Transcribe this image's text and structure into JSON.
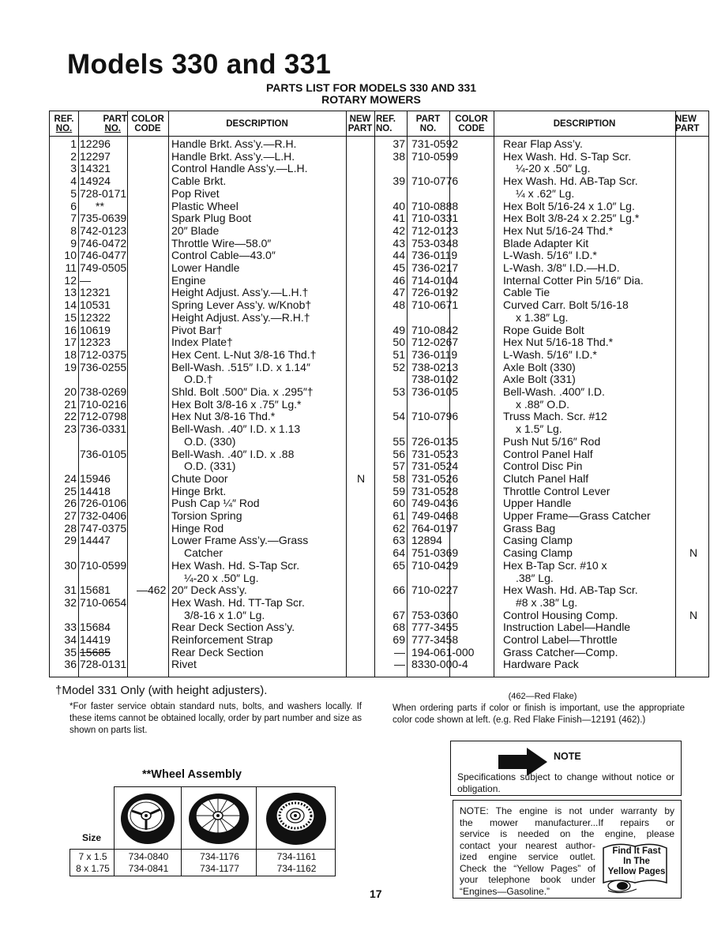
{
  "page": {
    "title": "Models 330 and 331",
    "subtitle_line1": "PARTS LIST FOR MODELS 330 AND 331",
    "subtitle_line2": "ROTARY MOWERS",
    "page_number": "17"
  },
  "table": {
    "headers": {
      "ref_no": [
        "REF.",
        "NO."
      ],
      "part_no": [
        "PART",
        "NO."
      ],
      "color_code": [
        "COLOR",
        "CODE"
      ],
      "description": "DESCRIPTION",
      "new_part": [
        "NEW",
        "PART"
      ]
    },
    "left_rows": [
      {
        "ref": "1",
        "part": "12296",
        "color": "",
        "desc": "Handle Brkt. Ass’y.—R.H.",
        "new": ""
      },
      {
        "ref": "2",
        "part": "12297",
        "color": "",
        "desc": "Handle Brkt. Ass’y.—L.H.",
        "new": ""
      },
      {
        "ref": "3",
        "part": "14321",
        "color": "",
        "desc": "Control Handle Ass’y.—L.H.",
        "new": ""
      },
      {
        "ref": "4",
        "part": "14924",
        "color": "",
        "desc": "Cable Brkt.",
        "new": ""
      },
      {
        "ref": "5",
        "part": "728-0171",
        "color": "",
        "desc": "Pop Rivet",
        "new": ""
      },
      {
        "ref": "6",
        "part": "**",
        "color": "",
        "desc": "Plastic Wheel",
        "new": ""
      },
      {
        "ref": "7",
        "part": "735-0639",
        "color": "",
        "desc": "Spark Plug Boot",
        "new": ""
      },
      {
        "ref": "8",
        "part": "742-0123",
        "color": "",
        "desc": "20″ Blade",
        "new": ""
      },
      {
        "ref": "9",
        "part": "746-0472",
        "color": "",
        "desc": "Throttle Wire—58.0″",
        "new": ""
      },
      {
        "ref": "10",
        "part": "746-0477",
        "color": "",
        "desc": "Control Cable—43.0″",
        "new": ""
      },
      {
        "ref": "11",
        "part": "749-0505",
        "color": "",
        "desc": "Lower Handle",
        "new": ""
      },
      {
        "ref": "12",
        "part": "—",
        "color": "",
        "desc": "Engine",
        "new": ""
      },
      {
        "ref": "13",
        "part": "12321",
        "color": "",
        "desc": "Height Adjust. Ass’y.—L.H.†",
        "new": ""
      },
      {
        "ref": "14",
        "part": "10531",
        "color": "",
        "desc": "Spring Lever Ass’y. w/Knob†",
        "new": ""
      },
      {
        "ref": "15",
        "part": "12322",
        "color": "",
        "desc": "Height Adjust. Ass’y.—R.H.†",
        "new": ""
      },
      {
        "ref": "16",
        "part": "10619",
        "color": "",
        "desc": "Pivot Bar†",
        "new": ""
      },
      {
        "ref": "17",
        "part": "12323",
        "color": "",
        "desc": "Index Plate†",
        "new": ""
      },
      {
        "ref": "18",
        "part": "712-0375",
        "color": "",
        "desc": "Hex Cent. L-Nut 3/8-16 Thd.†",
        "new": ""
      },
      {
        "ref": "19",
        "part": "736-0255",
        "color": "",
        "desc": "Bell-Wash. .515″ I.D. x 1.14″",
        "new": ""
      },
      {
        "ref": "",
        "part": "",
        "color": "",
        "desc": "O.D.†",
        "new": "",
        "indent": true
      },
      {
        "ref": "20",
        "part": "738-0269",
        "color": "",
        "desc": "Shld. Bolt .500″ Dia. x .295″†",
        "new": ""
      },
      {
        "ref": "21",
        "part": "710-0216",
        "color": "",
        "desc": "Hex Bolt 3/8-16 x .75″ Lg.*",
        "new": ""
      },
      {
        "ref": "22",
        "part": "712-0798",
        "color": "",
        "desc": "Hex Nut 3/8-16 Thd.*",
        "new": ""
      },
      {
        "ref": "23",
        "part": "736-0331",
        "color": "",
        "desc": "Bell-Wash. .40″ I.D. x 1.13",
        "new": ""
      },
      {
        "ref": "",
        "part": "",
        "color": "",
        "desc": "O.D. (330)",
        "new": "",
        "indent": true
      },
      {
        "ref": "",
        "part": "736-0105",
        "color": "",
        "desc": "Bell-Wash. .40″ I.D. x .88",
        "new": ""
      },
      {
        "ref": "",
        "part": "",
        "color": "",
        "desc": "O.D. (331)",
        "new": "",
        "indent": true
      },
      {
        "ref": "24",
        "part": "15946",
        "color": "",
        "desc": "Chute Door",
        "new": "N"
      },
      {
        "ref": "25",
        "part": "14418",
        "color": "",
        "desc": "Hinge Brkt.",
        "new": ""
      },
      {
        "ref": "26",
        "part": "726-0106",
        "color": "",
        "desc": "Push Cap ¼″ Rod",
        "new": ""
      },
      {
        "ref": "27",
        "part": "732-0406",
        "color": "",
        "desc": "Torsion Spring",
        "new": ""
      },
      {
        "ref": "28",
        "part": "747-0375",
        "color": "",
        "desc": "Hinge Rod",
        "new": ""
      },
      {
        "ref": "29",
        "part": "14447",
        "color": "",
        "desc": "Lower Frame Ass’y.—Grass",
        "new": ""
      },
      {
        "ref": "",
        "part": "",
        "color": "",
        "desc": "Catcher",
        "new": "",
        "indent": true
      },
      {
        "ref": "30",
        "part": "710-0599",
        "color": "",
        "desc": "Hex Wash. Hd. S-Tap Scr.",
        "new": ""
      },
      {
        "ref": "",
        "part": "",
        "color": "",
        "desc": "¼-20 x .50″ Lg.",
        "new": "",
        "indent": true
      },
      {
        "ref": "31",
        "part": "15681",
        "color": "—462",
        "desc": "20″ Deck Ass’y.",
        "new": ""
      },
      {
        "ref": "32",
        "part": "710-0654",
        "color": "",
        "desc": "Hex Wash. Hd. TT-Tap Scr.",
        "new": ""
      },
      {
        "ref": "",
        "part": "",
        "color": "",
        "desc": "3/8-16 x 1.0″ Lg.",
        "new": "",
        "indent": true
      },
      {
        "ref": "33",
        "part": "15684",
        "color": "",
        "desc": "Rear Deck Section Ass’y.",
        "new": ""
      },
      {
        "ref": "34",
        "part": "14419",
        "color": "",
        "desc": "Reinforcement Strap",
        "new": ""
      },
      {
        "ref": "35",
        "part": "15685",
        "color": "",
        "desc": "Rear Deck Section",
        "new": "",
        "struck": true
      },
      {
        "ref": "36",
        "part": "728-0131",
        "color": "",
        "desc": "Rivet",
        "new": ""
      }
    ],
    "right_rows": [
      {
        "ref": "37",
        "part": "731-0592",
        "color": "",
        "desc": "Rear Flap Ass’y.",
        "new": ""
      },
      {
        "ref": "38",
        "part": "710-0599",
        "color": "",
        "desc": "Hex Wash. Hd. S-Tap Scr.",
        "new": ""
      },
      {
        "ref": "",
        "part": "",
        "color": "",
        "desc": "¼-20 x .50″ Lg.",
        "new": "",
        "indent": true
      },
      {
        "ref": "39",
        "part": "710-0776",
        "color": "",
        "desc": "Hex Wash. Hd. AB-Tap Scr.",
        "new": ""
      },
      {
        "ref": "",
        "part": "",
        "color": "",
        "desc": "¼ x .62″ Lg.",
        "new": "",
        "indent": true
      },
      {
        "ref": "40",
        "part": "710-0888",
        "color": "",
        "desc": "Hex Bolt 5/16-24 x 1.0″ Lg.",
        "new": ""
      },
      {
        "ref": "41",
        "part": "710-0331",
        "color": "",
        "desc": "Hex Bolt 3/8-24 x 2.25″ Lg.*",
        "new": ""
      },
      {
        "ref": "42",
        "part": "712-0123",
        "color": "",
        "desc": "Hex Nut 5/16-24 Thd.*",
        "new": ""
      },
      {
        "ref": "43",
        "part": "753-0348",
        "color": "",
        "desc": "Blade Adapter Kit",
        "new": ""
      },
      {
        "ref": "44",
        "part": "736-0119",
        "color": "",
        "desc": "L-Wash. 5/16″ I.D.*",
        "new": ""
      },
      {
        "ref": "45",
        "part": "736-0217",
        "color": "",
        "desc": "L-Wash. 3/8″ I.D.—H.D.",
        "new": ""
      },
      {
        "ref": "46",
        "part": "714-0104",
        "color": "",
        "desc": "Internal Cotter Pin 5/16″ Dia.",
        "new": ""
      },
      {
        "ref": "47",
        "part": "726-0192",
        "color": "",
        "desc": "Cable Tie",
        "new": ""
      },
      {
        "ref": "48",
        "part": "710-0671",
        "color": "",
        "desc": "Curved Carr. Bolt 5/16-18",
        "new": ""
      },
      {
        "ref": "",
        "part": "",
        "color": "",
        "desc": "x 1.38″ Lg.",
        "new": "",
        "indent": true
      },
      {
        "ref": "49",
        "part": "710-0842",
        "color": "",
        "desc": "Rope Guide Bolt",
        "new": ""
      },
      {
        "ref": "50",
        "part": "712-0267",
        "color": "",
        "desc": "Hex Nut 5/16-18 Thd.*",
        "new": ""
      },
      {
        "ref": "51",
        "part": "736-0119",
        "color": "",
        "desc": "L-Wash. 5/16″ I.D.*",
        "new": ""
      },
      {
        "ref": "52",
        "part": "738-0213",
        "color": "",
        "desc": "Axle Bolt (330)",
        "new": ""
      },
      {
        "ref": "",
        "part": "738-0102",
        "color": "",
        "desc": "Axle Bolt (331)",
        "new": ""
      },
      {
        "ref": "53",
        "part": "736-0105",
        "color": "",
        "desc": "Bell-Wash. .400″ I.D.",
        "new": ""
      },
      {
        "ref": "",
        "part": "",
        "color": "",
        "desc": "x .88″ O.D.",
        "new": "",
        "indent": true
      },
      {
        "ref": "54",
        "part": "710-0796",
        "color": "",
        "desc": "Truss Mach. Scr. #12",
        "new": ""
      },
      {
        "ref": "",
        "part": "",
        "color": "",
        "desc": "x 1.5″ Lg.",
        "new": "",
        "indent": true
      },
      {
        "ref": "55",
        "part": "726-0135",
        "color": "",
        "desc": "Push Nut 5/16″ Rod",
        "new": ""
      },
      {
        "ref": "56",
        "part": "731-0523",
        "color": "",
        "desc": "Control Panel Half",
        "new": ""
      },
      {
        "ref": "57",
        "part": "731-0524",
        "color": "",
        "desc": "Control Disc Pin",
        "new": ""
      },
      {
        "ref": "58",
        "part": "731-0526",
        "color": "",
        "desc": "Clutch Panel Half",
        "new": ""
      },
      {
        "ref": "59",
        "part": "731-0528",
        "color": "",
        "desc": "Throttle Control Lever",
        "new": ""
      },
      {
        "ref": "60",
        "part": "749-0436",
        "color": "",
        "desc": "Upper Handle",
        "new": ""
      },
      {
        "ref": "61",
        "part": "749-0468",
        "color": "",
        "desc": "Upper Frame—Grass Catcher",
        "new": ""
      },
      {
        "ref": "62",
        "part": "764-0197",
        "color": "",
        "desc": "Grass Bag",
        "new": ""
      },
      {
        "ref": "63",
        "part": "12894",
        "color": "",
        "desc": "Casing Clamp",
        "new": ""
      },
      {
        "ref": "64",
        "part": "751-0369",
        "color": "",
        "desc": "Casing Clamp",
        "new": "N"
      },
      {
        "ref": "65",
        "part": "710-0429",
        "color": "",
        "desc": "Hex B-Tap Scr. #10 x",
        "new": ""
      },
      {
        "ref": "",
        "part": "",
        "color": "",
        "desc": ".38″ Lg.",
        "new": "",
        "indent": true
      },
      {
        "ref": "66",
        "part": "710-0227",
        "color": "",
        "desc": "Hex Wash. Hd. AB-Tap Scr.",
        "new": ""
      },
      {
        "ref": "",
        "part": "",
        "color": "",
        "desc": "#8 x .38″ Lg.",
        "new": "",
        "indent": true
      },
      {
        "ref": "67",
        "part": "753-0360",
        "color": "",
        "desc": "Control Housing Comp.",
        "new": "N"
      },
      {
        "ref": "68",
        "part": "777-3455",
        "color": "",
        "desc": "Instruction Label—Handle",
        "new": ""
      },
      {
        "ref": "69",
        "part": "777-3458",
        "color": "",
        "desc": "Control Label—Throttle",
        "new": ""
      },
      {
        "ref": "—",
        "part": "194-061-000",
        "color": "",
        "desc": "Grass Catcher—Comp.",
        "new": ""
      },
      {
        "ref": "—",
        "part": "8330-000-4",
        "color": "",
        "desc": "Hardware Pack",
        "new": ""
      }
    ]
  },
  "footnotes": {
    "dagger": "†Model 331 Only (with height adjusters).",
    "star": "*For faster service obtain standard nuts, bolts, and washers locally. If these items cannot be obtained locally, order by part number and size as shown on parts list.",
    "color_code": "(462—Red Flake)",
    "color_order": "When ordering parts if color or finish is important, use the appropriate color code shown at left. (e.g. Red Flake Finish—12191 (462).)"
  },
  "note_box": {
    "title": "NOTE",
    "text": "Specifications subject to change without notice or obligation."
  },
  "engine_note": {
    "lines": [
      "NOTE: The engine is not under warranty by",
      "the mower manufacturer...If repairs or",
      "service is needed on the engine, please",
      "contact your nearest author-",
      "ized engine service outlet.",
      "Check the “Yellow Pages” of",
      "your telephone book under",
      "“Engines—Gasoline.”"
    ],
    "sign": [
      "Find It Fast",
      "In The",
      "Yellow Pages"
    ]
  },
  "wheel_assembly": {
    "title": "**Wheel Assembly",
    "size_label": "Size",
    "sizes": [
      "7 x 1.5",
      "8 x 1.75"
    ],
    "wheels": [
      {
        "icon": "three-spoke-wheel",
        "parts": [
          "734-0840",
          "734-0841"
        ]
      },
      {
        "icon": "wire-spoke-wheel",
        "parts": [
          "734-1176",
          "734-1177"
        ]
      },
      {
        "icon": "decorative-hub-wheel",
        "parts": [
          "734-1161",
          "734-1162"
        ]
      }
    ]
  }
}
